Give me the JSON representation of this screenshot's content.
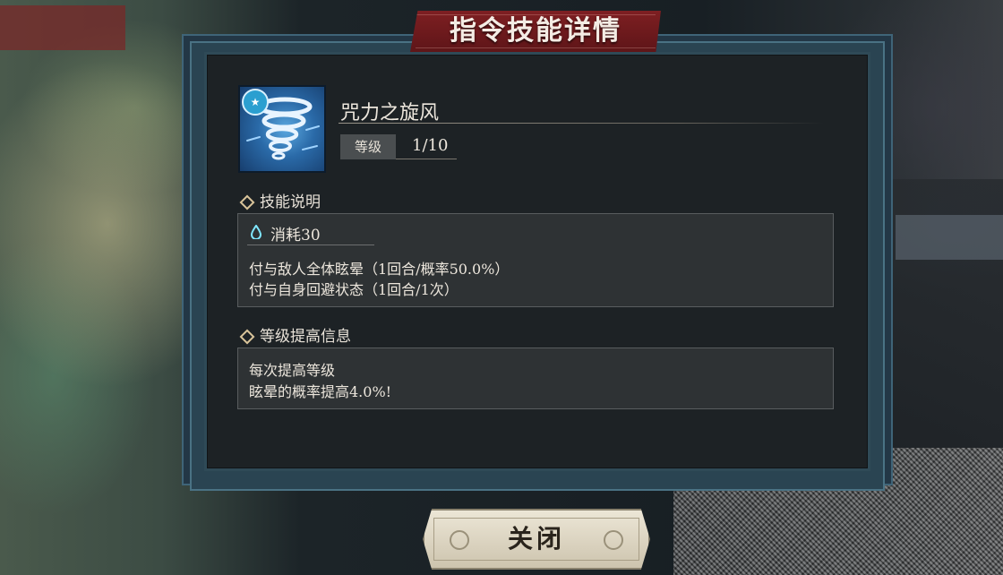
{
  "dialog": {
    "title": "指令技能详情"
  },
  "skill": {
    "name": "咒力之旋风",
    "level_label": "等级",
    "level_value": "1/10",
    "icon": "whirlwind-icon",
    "badge_icon": "star-icon"
  },
  "description": {
    "heading": "技能说明",
    "cost_icon": "mana-drop-icon",
    "cost": "消耗30",
    "lines": [
      "付与敌人全体眩晕（1回合/概率50.0%）",
      "付与自身回避状态（1回合/1次）"
    ]
  },
  "upgrade": {
    "heading": "等级提高信息",
    "lines": [
      "每次提高等级",
      "眩晕的概率提高4.0%!"
    ]
  },
  "buttons": {
    "close": "关闭"
  },
  "colors": {
    "ribbon": "#7e1f22",
    "panel": "#1d2225",
    "frame": "#2f4a57",
    "accent_diamond": "#d9c49a",
    "button": "#e4dcc8"
  }
}
